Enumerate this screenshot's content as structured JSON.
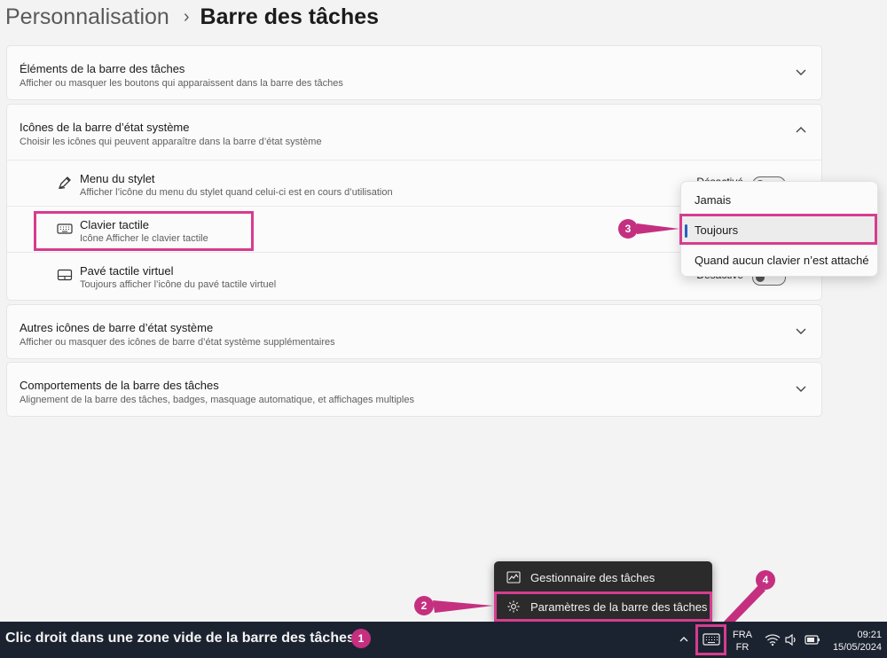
{
  "breadcrumb": {
    "parent": "Personnalisation",
    "separator": "›",
    "current": "Barre des tâches"
  },
  "sections": [
    {
      "title": "Éléments de la barre des tâches",
      "subtitle": "Afficher ou masquer les boutons qui apparaissent dans la barre des tâches",
      "expanded": false
    },
    {
      "title": "Icônes de la barre d’état système",
      "subtitle": "Choisir les icônes qui peuvent apparaître dans la barre d’état système",
      "expanded": true,
      "items": [
        {
          "title": "Menu du stylet",
          "description": "Afficher l’icône du menu du stylet quand celui-ci est en cours d’utilisation",
          "icon": "pen-icon",
          "value": "Désactivé"
        },
        {
          "title": "Clavier tactile",
          "description": "Icône Afficher le clavier tactile",
          "icon": "keyboard-icon"
        },
        {
          "title": "Pavé tactile virtuel",
          "description": "Toujours afficher l’icône du pavé tactile virtuel",
          "icon": "touchpad-icon",
          "value": "Désactivé"
        }
      ]
    },
    {
      "title": "Autres icônes de barre d’état système",
      "subtitle": "Afficher ou masquer des icônes de barre d’état système supplémentaires",
      "expanded": false
    },
    {
      "title": "Comportements de la barre des tâches",
      "subtitle": "Alignement de la barre des tâches, badges, masquage automatique, et affichages multiples",
      "expanded": false
    }
  ],
  "dropdown": {
    "options": [
      "Jamais",
      "Toujours",
      "Quand aucun clavier n’est attaché"
    ],
    "selected": "Toujours"
  },
  "context_menu": {
    "items": [
      {
        "label": "Gestionnaire des tâches",
        "icon": "task-manager-icon"
      },
      {
        "label": "Paramètres de la barre des tâches",
        "icon": "gear-icon"
      }
    ]
  },
  "taskbar": {
    "caption": "Clic droit dans une zone vide de la barre des tâches",
    "lang_primary": "FRA",
    "lang_secondary": "FR",
    "time": "09:21",
    "date": "15/05/2024",
    "tray_icons": [
      "chevron-up-icon",
      "keyboard-icon",
      "wifi-icon",
      "speaker-icon",
      "battery-icon"
    ]
  },
  "annotations": [
    "1",
    "2",
    "3",
    "4"
  ],
  "colors": {
    "highlight": "#d63c8f",
    "badge": "#c4307f",
    "accent": "#2a5fbd",
    "taskbar": "#1c2330"
  }
}
